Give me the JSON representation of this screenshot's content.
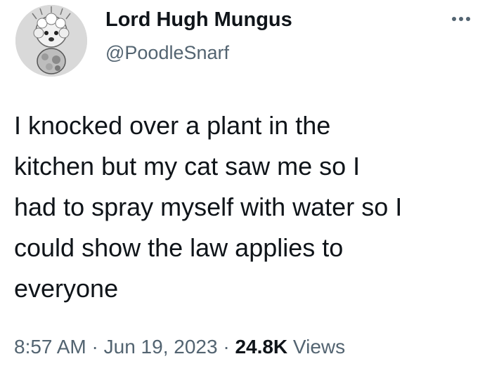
{
  "author": {
    "display_name": "Lord Hugh Mungus",
    "handle": "@PoodleSnarf",
    "avatar_icon": "poodle-avatar-icon"
  },
  "tweet": {
    "text": "I knocked over a plant in the\nkitchen but my cat saw me so I\nhad to spray myself with water so I\ncould show the law applies to\neveryone"
  },
  "meta": {
    "time": "8:57 AM",
    "separator": " · ",
    "date": "Jun 19, 2023",
    "views_count": "24.8K",
    "views_label": " Views"
  },
  "icons": {
    "more": "more-options-icon"
  },
  "colors": {
    "primary_text": "#0f1419",
    "secondary_text": "#536471",
    "background": "#ffffff"
  }
}
